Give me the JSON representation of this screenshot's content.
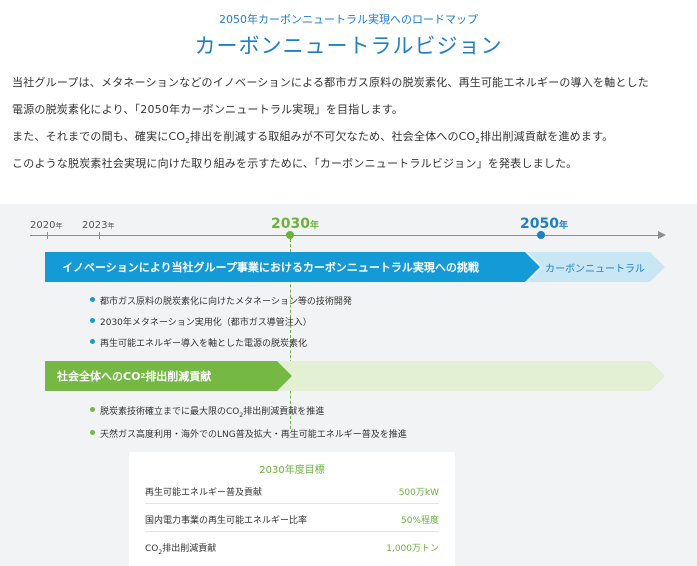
{
  "header": {
    "subtitle": "2050年カーボンニュートラル実現へのロードマップ",
    "title": "カーボンニュートラルビジョン"
  },
  "intro": {
    "line1": "当社グループは、メタネーションなどのイノベーションによる都市ガス原料の脱炭素化、再生可能エネルギーの導入を軸とした",
    "line2": "電源の脱炭素化により、「2050年カーボンニュートラル実現」を目指します。",
    "line3a": "また、それまでの間も、確実にCO",
    "line3b": "排出を削減する取組みが不可欠なため、社会全体へのCO",
    "line3c": "排出削減貢献を進めます。",
    "line4": "このような脱炭素社会実現に向けた取り組みを示すために、「カーボンニュートラルビジョン」を発表しました。",
    "subscript": "2"
  },
  "timeline": {
    "nen": "年",
    "years": [
      {
        "year": "2020"
      },
      {
        "year": "2023"
      },
      {
        "year": "2030"
      },
      {
        "year": "2050"
      }
    ]
  },
  "roadmap": {
    "innovation_band": {
      "label": "イノベーションにより当社グループ事業におけるカーボンニュートラル実現への挑戦",
      "goal": "カーボンニュートラル",
      "bullets": [
        "都市ガス原料の脱炭素化に向けたメタネーション等の技術開発",
        "2030年メタネーション実用化（都市ガス導管注入）",
        "再生可能エネルギー導入を軸とした電源の脱炭素化"
      ]
    },
    "society_band": {
      "label_a": "社会全体へのCO",
      "label_b": "排出削減貢献",
      "bullets": [
        {
          "a": "脱炭素技術確立までに最大限のCO",
          "b": "排出削減貢献を推進"
        },
        {
          "a": "天然ガス高度利用・海外でのLNG普及拡大・再生可能エネルギー普及を推進",
          "b": ""
        }
      ]
    }
  },
  "targets": {
    "title": "2030年度目標",
    "rows": [
      {
        "label": "再生可能エネルギー普及貢献",
        "value": "500万kW"
      },
      {
        "label": "国内電力事業の再生可能エネルギー比率",
        "value": "50%程度"
      },
      {
        "label_a": "CO",
        "label_b": "排出削減貢献",
        "value": "1,000万トン"
      }
    ]
  },
  "colors": {
    "blue": "#1f7fc6",
    "band_blue": "#159ad8",
    "goal_blue": "#c9e6f5",
    "green": "#6cb33e",
    "band_green": "#75b843",
    "green_fill": "#e4f0d3"
  }
}
